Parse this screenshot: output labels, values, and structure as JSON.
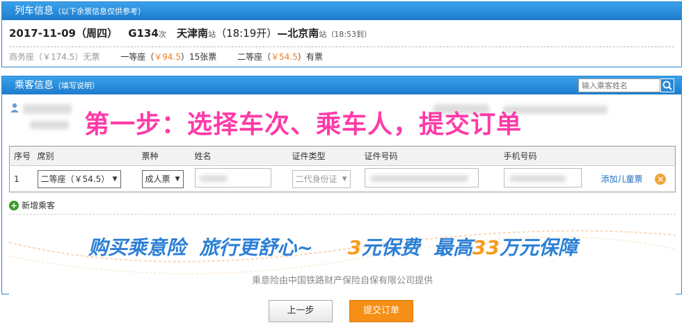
{
  "train_panel": {
    "title": "列车信息",
    "subtitle": "（以下余票信息仅供参考）",
    "date": "2017-11-09（周四）",
    "train_no": "G134",
    "train_no_suffix": "次",
    "from_station": "天津南",
    "from_suffix": "站",
    "depart_time": "（18:19开）",
    "arrow": "—",
    "to_station": "北京南",
    "to_suffix": "站",
    "arrive_time": "（18:53到）",
    "seats": [
      {
        "name": "商务座（",
        "price": "￥174.5",
        "close": "）",
        "status": "无票",
        "muted": true
      },
      {
        "name": "一等座（",
        "price": "￥94.5",
        "close": "）",
        "status": "15张票",
        "muted": false
      },
      {
        "name": "二等座（",
        "price": "￥54.5",
        "close": "）",
        "status": "有票",
        "muted": false
      }
    ]
  },
  "passenger_panel": {
    "title": "乘客信息",
    "subtitle": "（填写说明）",
    "search_placeholder": "输入乘客姓名",
    "step_text": "第一步：选择车次、乘车人，提交订单",
    "table": {
      "headers": [
        "序号",
        "席别",
        "票种",
        "姓名",
        "证件类型",
        "证件号码",
        "手机号码"
      ],
      "row": {
        "index": "1",
        "seat": "二等座（￥54.5）",
        "ticket_type": "成人票",
        "id_type": "二代身份证",
        "add_child": "添加儿童票"
      }
    },
    "add_passenger": "新增乘客",
    "insurance": {
      "part1": "购买乘意险",
      "part2": "旅行更舒心~",
      "part3a": "3",
      "part3b": "元保费",
      "part4a": "最高",
      "part4b": "33",
      "part4c": "万元保障",
      "sub": "乘意险由中国铁路财产保险自保有限公司提供"
    }
  },
  "buttons": {
    "prev": "上一步",
    "submit": "提交订单"
  },
  "colors": {
    "header_blue": "#2b87d1",
    "price_orange": "#f07e1d",
    "step_pink": "#ff3aa8",
    "submit_orange": "#f58f15",
    "insurance_blue": "#2b7fd6"
  }
}
